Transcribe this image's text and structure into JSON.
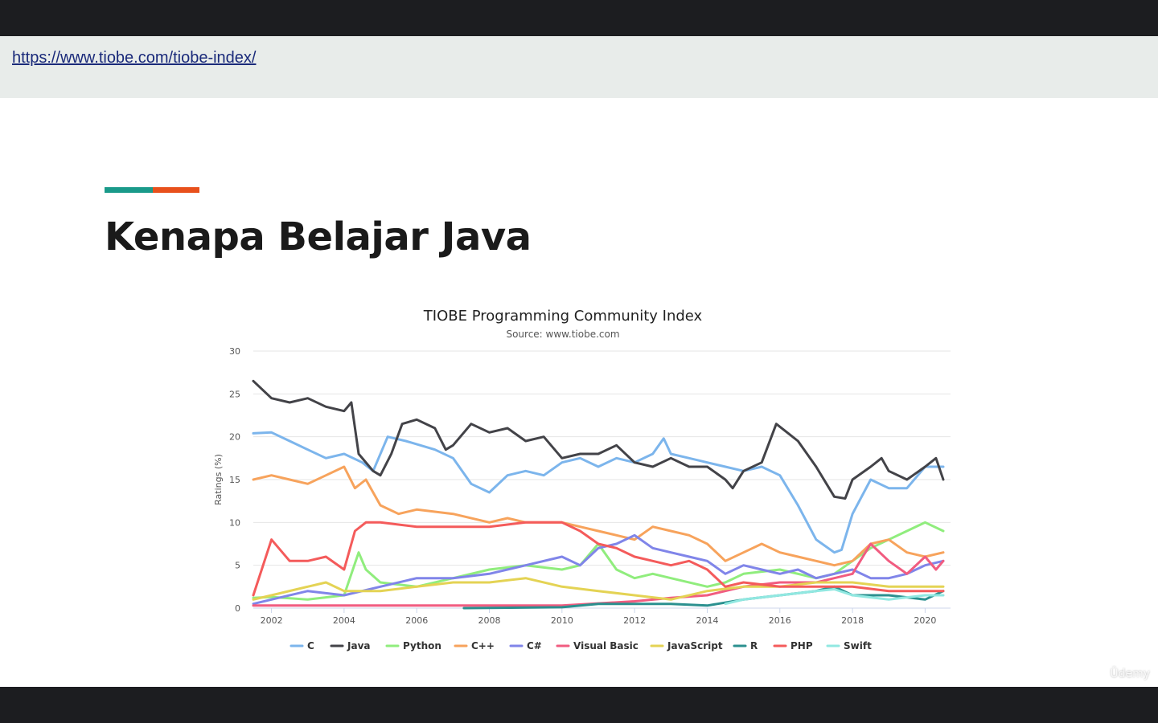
{
  "url": "https://www.tiobe.com/tiobe-index/",
  "slide": {
    "title": "Kenapa Belajar Java",
    "accent_colors": [
      "#1a9a8a",
      "#e8501c"
    ]
  },
  "watermark": "Ûdemy",
  "chart_data": {
    "type": "line",
    "title": "TIOBE Programming Community Index",
    "subtitle": "Source: www.tiobe.com",
    "ylabel": "Ratings (%)",
    "xlabel": "",
    "xlim": [
      2001.5,
      2020.7
    ],
    "ylim": [
      0,
      30
    ],
    "yticks": [
      0,
      5,
      10,
      15,
      20,
      25,
      30
    ],
    "xticks": [
      2002,
      2004,
      2006,
      2008,
      2010,
      2012,
      2014,
      2016,
      2018,
      2020
    ],
    "grid": true,
    "legend_position": "bottom",
    "series": [
      {
        "name": "C",
        "color": "#7cb5ec",
        "points": [
          [
            2001.5,
            20.4
          ],
          [
            2002,
            20.5
          ],
          [
            2002.5,
            19.5
          ],
          [
            2003,
            18.5
          ],
          [
            2003.5,
            17.5
          ],
          [
            2004,
            18.0
          ],
          [
            2004.5,
            17.0
          ],
          [
            2004.8,
            16.0
          ],
          [
            2005.2,
            20.0
          ],
          [
            2005.7,
            19.5
          ],
          [
            2006.5,
            18.5
          ],
          [
            2007,
            17.5
          ],
          [
            2007.5,
            14.5
          ],
          [
            2008,
            13.5
          ],
          [
            2008.5,
            15.5
          ],
          [
            2009,
            16.0
          ],
          [
            2009.5,
            15.5
          ],
          [
            2010,
            17.0
          ],
          [
            2010.5,
            17.5
          ],
          [
            2011,
            16.5
          ],
          [
            2011.5,
            17.5
          ],
          [
            2012,
            17.0
          ],
          [
            2012.5,
            18.0
          ],
          [
            2012.8,
            19.8
          ],
          [
            2013,
            18.0
          ],
          [
            2013.5,
            17.5
          ],
          [
            2014,
            17.0
          ],
          [
            2014.5,
            16.5
          ],
          [
            2015,
            16.0
          ],
          [
            2015.5,
            16.5
          ],
          [
            2016,
            15.5
          ],
          [
            2016.5,
            12.0
          ],
          [
            2017,
            8.0
          ],
          [
            2017.5,
            6.5
          ],
          [
            2017.7,
            6.8
          ],
          [
            2018,
            11.0
          ],
          [
            2018.5,
            15.0
          ],
          [
            2019,
            14.0
          ],
          [
            2019.5,
            14.0
          ],
          [
            2020,
            16.5
          ],
          [
            2020.5,
            16.5
          ]
        ]
      },
      {
        "name": "Java",
        "color": "#434348",
        "points": [
          [
            2001.5,
            26.5
          ],
          [
            2002,
            24.5
          ],
          [
            2002.5,
            24.0
          ],
          [
            2003,
            24.5
          ],
          [
            2003.5,
            23.5
          ],
          [
            2004,
            23.0
          ],
          [
            2004.2,
            24.0
          ],
          [
            2004.4,
            18.0
          ],
          [
            2004.8,
            16.0
          ],
          [
            2005,
            15.5
          ],
          [
            2005.3,
            18.0
          ],
          [
            2005.6,
            21.5
          ],
          [
            2006,
            22.0
          ],
          [
            2006.5,
            21.0
          ],
          [
            2006.8,
            18.5
          ],
          [
            2007,
            19.0
          ],
          [
            2007.5,
            21.5
          ],
          [
            2008,
            20.5
          ],
          [
            2008.5,
            21.0
          ],
          [
            2009,
            19.5
          ],
          [
            2009.5,
            20.0
          ],
          [
            2010,
            17.5
          ],
          [
            2010.5,
            18.0
          ],
          [
            2011,
            18.0
          ],
          [
            2011.5,
            19.0
          ],
          [
            2012,
            17.0
          ],
          [
            2012.5,
            16.5
          ],
          [
            2013,
            17.5
          ],
          [
            2013.5,
            16.5
          ],
          [
            2014,
            16.5
          ],
          [
            2014.5,
            15.0
          ],
          [
            2014.7,
            14.0
          ],
          [
            2015,
            16.0
          ],
          [
            2015.5,
            17.0
          ],
          [
            2015.9,
            21.5
          ],
          [
            2016.2,
            20.5
          ],
          [
            2016.5,
            19.5
          ],
          [
            2017,
            16.5
          ],
          [
            2017.5,
            13.0
          ],
          [
            2017.8,
            12.8
          ],
          [
            2018,
            15.0
          ],
          [
            2018.5,
            16.5
          ],
          [
            2018.8,
            17.5
          ],
          [
            2019,
            16.0
          ],
          [
            2019.5,
            15.0
          ],
          [
            2020,
            16.5
          ],
          [
            2020.3,
            17.5
          ],
          [
            2020.5,
            15.0
          ]
        ]
      },
      {
        "name": "Python",
        "color": "#90ed7d",
        "points": [
          [
            2001.5,
            1.2
          ],
          [
            2002,
            1.3
          ],
          [
            2003,
            1.0
          ],
          [
            2004,
            1.5
          ],
          [
            2004.4,
            6.5
          ],
          [
            2004.6,
            4.5
          ],
          [
            2005,
            3.0
          ],
          [
            2006,
            2.5
          ],
          [
            2007,
            3.5
          ],
          [
            2008,
            4.5
          ],
          [
            2009,
            5.0
          ],
          [
            2010,
            4.5
          ],
          [
            2010.5,
            5.0
          ],
          [
            2011,
            7.5
          ],
          [
            2011.5,
            4.5
          ],
          [
            2012,
            3.5
          ],
          [
            2012.5,
            4.0
          ],
          [
            2013,
            3.5
          ],
          [
            2014,
            2.5
          ],
          [
            2014.5,
            3.0
          ],
          [
            2015,
            4.0
          ],
          [
            2016,
            4.5
          ],
          [
            2017,
            3.5
          ],
          [
            2017.5,
            4.0
          ],
          [
            2018,
            5.5
          ],
          [
            2018.5,
            7.0
          ],
          [
            2019,
            8.0
          ],
          [
            2019.5,
            9.0
          ],
          [
            2020,
            10.0
          ],
          [
            2020.5,
            9.0
          ]
        ]
      },
      {
        "name": "C++",
        "color": "#f7a35c",
        "points": [
          [
            2001.5,
            15.0
          ],
          [
            2002,
            15.5
          ],
          [
            2002.5,
            15.0
          ],
          [
            2003,
            14.5
          ],
          [
            2003.5,
            15.5
          ],
          [
            2004,
            16.5
          ],
          [
            2004.3,
            14.0
          ],
          [
            2004.6,
            15.0
          ],
          [
            2005,
            12.0
          ],
          [
            2005.5,
            11.0
          ],
          [
            2006,
            11.5
          ],
          [
            2007,
            11.0
          ],
          [
            2008,
            10.0
          ],
          [
            2008.5,
            10.5
          ],
          [
            2009,
            10.0
          ],
          [
            2010,
            10.0
          ],
          [
            2010.5,
            9.5
          ],
          [
            2011,
            9.0
          ],
          [
            2011.5,
            8.5
          ],
          [
            2012,
            8.0
          ],
          [
            2012.5,
            9.5
          ],
          [
            2013,
            9.0
          ],
          [
            2013.5,
            8.5
          ],
          [
            2014,
            7.5
          ],
          [
            2014.5,
            5.5
          ],
          [
            2015,
            6.5
          ],
          [
            2015.5,
            7.5
          ],
          [
            2016,
            6.5
          ],
          [
            2016.5,
            6.0
          ],
          [
            2017,
            5.5
          ],
          [
            2017.5,
            5.0
          ],
          [
            2018,
            5.5
          ],
          [
            2018.5,
            7.5
          ],
          [
            2019,
            8.0
          ],
          [
            2019.5,
            6.5
          ],
          [
            2020,
            6.0
          ],
          [
            2020.5,
            6.5
          ]
        ]
      },
      {
        "name": "C#",
        "color": "#8085e9",
        "points": [
          [
            2001.5,
            0.5
          ],
          [
            2002,
            1.0
          ],
          [
            2003,
            2.0
          ],
          [
            2004,
            1.5
          ],
          [
            2005,
            2.5
          ],
          [
            2006,
            3.5
          ],
          [
            2007,
            3.5
          ],
          [
            2008,
            4.0
          ],
          [
            2009,
            5.0
          ],
          [
            2010,
            6.0
          ],
          [
            2010.5,
            5.0
          ],
          [
            2011,
            7.0
          ],
          [
            2011.5,
            7.5
          ],
          [
            2012,
            8.5
          ],
          [
            2012.5,
            7.0
          ],
          [
            2013,
            6.5
          ],
          [
            2013.5,
            6.0
          ],
          [
            2014,
            5.5
          ],
          [
            2014.5,
            4.0
          ],
          [
            2015,
            5.0
          ],
          [
            2015.5,
            4.5
          ],
          [
            2016,
            4.0
          ],
          [
            2016.5,
            4.5
          ],
          [
            2017,
            3.5
          ],
          [
            2017.5,
            4.0
          ],
          [
            2018,
            4.5
          ],
          [
            2018.5,
            3.5
          ],
          [
            2019,
            3.5
          ],
          [
            2019.5,
            4.0
          ],
          [
            2020,
            5.0
          ],
          [
            2020.5,
            5.5
          ]
        ]
      },
      {
        "name": "Visual Basic",
        "color": "#f15c80",
        "points": [
          [
            2001.5,
            0.3
          ],
          [
            2005,
            0.3
          ],
          [
            2010,
            0.3
          ],
          [
            2012,
            0.8
          ],
          [
            2013,
            1.2
          ],
          [
            2014,
            1.5
          ],
          [
            2015,
            2.5
          ],
          [
            2016,
            3.0
          ],
          [
            2017,
            3.0
          ],
          [
            2018,
            4.0
          ],
          [
            2018.5,
            7.5
          ],
          [
            2019,
            5.5
          ],
          [
            2019.5,
            4.0
          ],
          [
            2020,
            6.0
          ],
          [
            2020.3,
            4.5
          ],
          [
            2020.5,
            5.5
          ]
        ]
      },
      {
        "name": "JavaScript",
        "color": "#e4d354",
        "points": [
          [
            2001.5,
            1.0
          ],
          [
            2002,
            1.5
          ],
          [
            2003,
            2.5
          ],
          [
            2003.5,
            3.0
          ],
          [
            2004,
            2.0
          ],
          [
            2005,
            2.0
          ],
          [
            2006,
            2.5
          ],
          [
            2007,
            3.0
          ],
          [
            2008,
            3.0
          ],
          [
            2009,
            3.5
          ],
          [
            2010,
            2.5
          ],
          [
            2011,
            2.0
          ],
          [
            2012,
            1.5
          ],
          [
            2013,
            1.0
          ],
          [
            2014,
            2.0
          ],
          [
            2015,
            2.5
          ],
          [
            2016,
            2.5
          ],
          [
            2017,
            3.0
          ],
          [
            2018,
            3.0
          ],
          [
            2019,
            2.5
          ],
          [
            2020,
            2.5
          ],
          [
            2020.5,
            2.5
          ]
        ]
      },
      {
        "name": "R",
        "color": "#2b908f",
        "points": [
          [
            2007.3,
            0.0
          ],
          [
            2010,
            0.1
          ],
          [
            2011,
            0.5
          ],
          [
            2012,
            0.5
          ],
          [
            2013,
            0.5
          ],
          [
            2014,
            0.3
          ],
          [
            2015,
            1.0
          ],
          [
            2016,
            1.5
          ],
          [
            2017,
            2.0
          ],
          [
            2017.5,
            2.5
          ],
          [
            2018,
            1.5
          ],
          [
            2019,
            1.5
          ],
          [
            2020,
            1.0
          ],
          [
            2020.5,
            2.0
          ]
        ]
      },
      {
        "name": "PHP",
        "color": "#f45b5b",
        "points": [
          [
            2001.5,
            1.5
          ],
          [
            2002,
            8.0
          ],
          [
            2002.5,
            5.5
          ],
          [
            2003,
            5.5
          ],
          [
            2003.5,
            6.0
          ],
          [
            2004,
            4.5
          ],
          [
            2004.3,
            9.0
          ],
          [
            2004.6,
            10.0
          ],
          [
            2005,
            10.0
          ],
          [
            2006,
            9.5
          ],
          [
            2007,
            9.5
          ],
          [
            2008,
            9.5
          ],
          [
            2009,
            10.0
          ],
          [
            2010,
            10.0
          ],
          [
            2010.5,
            9.0
          ],
          [
            2011,
            7.5
          ],
          [
            2011.5,
            7.0
          ],
          [
            2012,
            6.0
          ],
          [
            2012.5,
            5.5
          ],
          [
            2013,
            5.0
          ],
          [
            2013.5,
            5.5
          ],
          [
            2014,
            4.5
          ],
          [
            2014.5,
            2.5
          ],
          [
            2015,
            3.0
          ],
          [
            2016,
            2.5
          ],
          [
            2017,
            2.5
          ],
          [
            2018,
            2.5
          ],
          [
            2019,
            2.0
          ],
          [
            2020,
            2.0
          ],
          [
            2020.5,
            2.0
          ]
        ]
      },
      {
        "name": "Swift",
        "color": "#91e8e1",
        "points": [
          [
            2014.5,
            0.5
          ],
          [
            2015,
            1.0
          ],
          [
            2016,
            1.5
          ],
          [
            2017,
            2.0
          ],
          [
            2017.5,
            2.2
          ],
          [
            2018,
            1.5
          ],
          [
            2019,
            1.0
          ],
          [
            2020,
            1.5
          ],
          [
            2020.5,
            1.5
          ]
        ]
      }
    ]
  }
}
